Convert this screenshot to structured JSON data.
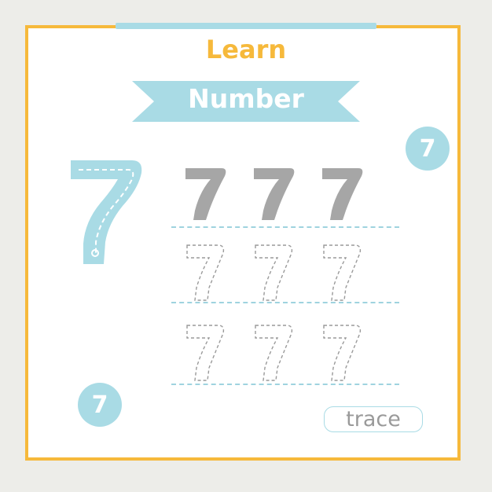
{
  "worksheet": {
    "title": "Learn",
    "subtitle": "Number",
    "digit": "7",
    "badge_top_right": "7",
    "badge_bottom_left": "7",
    "solid_examples": [
      "7",
      "7",
      "7"
    ],
    "trace_rows": [
      [
        "7",
        "7",
        "7"
      ],
      [
        "7",
        "7",
        "7"
      ]
    ],
    "trace_button_label": "trace"
  },
  "colors": {
    "frame": "#f6b93b",
    "accent_blue": "#a9dbe5",
    "solid_digit": "#a6a6a6",
    "trace_outline": "#9a9a9a",
    "background": "#edede9"
  },
  "icons": {
    "big_digit": "guided-seven-icon",
    "trace_digit": "dashed-seven-icon"
  }
}
